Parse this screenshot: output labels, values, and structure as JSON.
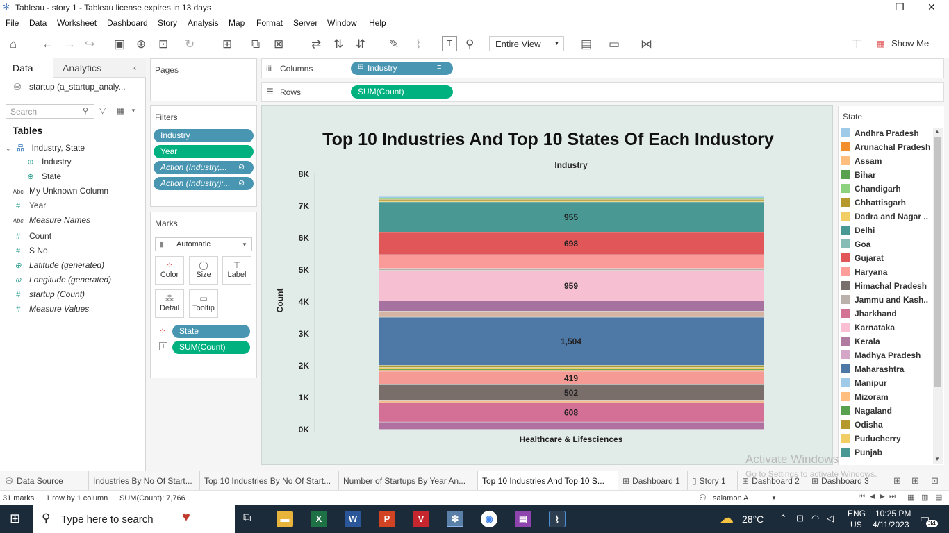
{
  "window": {
    "title": "Tableau - story  1 - Tableau license expires in 13 days"
  },
  "menu": [
    "File",
    "Data",
    "Worksheet",
    "Dashboard",
    "Story",
    "Analysis",
    "Map",
    "Format",
    "Server",
    "Window",
    "Help"
  ],
  "toolbar": {
    "fit": "Entire View",
    "show_me": "Show Me"
  },
  "data_pane": {
    "tabs": [
      "Data",
      "Analytics"
    ],
    "datasource": "startup (a_startup_analy...",
    "search_placeholder": "Search",
    "tables_header": "Tables",
    "group": "Industry, State",
    "fields": [
      "Industry",
      "State",
      "My Unknown Column",
      "Year",
      "Measure Names",
      "Count",
      "S No.",
      "Latitude (generated)",
      "Longitude (generated)",
      "startup (Count)",
      "Measure Values"
    ]
  },
  "shelves": {
    "pages": "Pages",
    "filters": "Filters",
    "filter_pills": [
      "Industry",
      "Year",
      "Action (Industry,...",
      "Action (Industry):..."
    ],
    "marks": "Marks",
    "mark_type": "Automatic",
    "mark_buttons": [
      "Color",
      "Size",
      "Label",
      "Detail",
      "Tooltip"
    ],
    "mark_pills": [
      "State",
      "SUM(Count)"
    ],
    "columns_label": "Columns",
    "columns_pill": "Industry",
    "rows_label": "Rows",
    "rows_pill": "SUM(Count)"
  },
  "chart_data": {
    "type": "bar",
    "title": "Top 10 Industries And Top 10 States Of Each Industory",
    "header": "Industry",
    "xlabel": "Healthcare & Lifesciences",
    "ylabel": "Count",
    "ylim": [
      0,
      8000
    ],
    "yticks": [
      "0K",
      "1K",
      "2K",
      "3K",
      "4K",
      "5K",
      "6K",
      "7K",
      "8K"
    ],
    "categories": [
      "Healthcare & Lifesciences"
    ],
    "segments": [
      {
        "state": "Kerala",
        "value": 230,
        "color": "#b070a0",
        "label": ""
      },
      {
        "state": "Jharkhand",
        "value": 608,
        "color": "#d46f96",
        "label": "608"
      },
      {
        "state": "Mizoram",
        "value": 60,
        "color": "#f4b98c",
        "label": ""
      },
      {
        "state": "Himachal Pradesh",
        "value": 502,
        "color": "#7a6e6b",
        "label": "502"
      },
      {
        "state": "Haryana",
        "value": 419,
        "color": "#f59a94",
        "label": "419"
      },
      {
        "state": "Arunachal Pradesh",
        "value": 40,
        "color": "#f28e2b",
        "label": ""
      },
      {
        "state": "Bihar",
        "value": 40,
        "color": "#5ea04a",
        "label": ""
      },
      {
        "state": "Puducherry",
        "value": 40,
        "color": "#f1ce63",
        "label": ""
      },
      {
        "state": "Odisha",
        "value": 70,
        "color": "#a89a34",
        "label": ""
      },
      {
        "state": "Maharashtra",
        "value": 1504,
        "color": "#4e79a7",
        "label": "1,504"
      },
      {
        "state": "Madhya Pradesh",
        "value": 190,
        "color": "#d5b4a3",
        "label": ""
      },
      {
        "state": "Kerala",
        "value": 320,
        "color": "#a673a0",
        "label": ""
      },
      {
        "state": "Karnataka",
        "value": 959,
        "color": "#f7bfd2",
        "label": "959"
      },
      {
        "state": "Jammu and Kashmir",
        "value": 60,
        "color": "#b8b0ac",
        "label": ""
      },
      {
        "state": "Haryana",
        "value": 430,
        "color": "#fa9b99",
        "label": ""
      },
      {
        "state": "Gujarat",
        "value": 698,
        "color": "#e15759",
        "label": "698"
      },
      {
        "state": "Delhi",
        "value": 955,
        "color": "#499894",
        "label": "955"
      },
      {
        "state": "Dadra and Nagar Haveli",
        "value": 40,
        "color": "#f1ce63",
        "label": ""
      },
      {
        "state": "Chhattisgarh",
        "value": 40,
        "color": "#b6992d",
        "label": ""
      },
      {
        "state": "Chandigarh",
        "value": 30,
        "color": "#8cd17d",
        "label": ""
      },
      {
        "state": "Andhra Pradesh",
        "value": 60,
        "color": "#a0cbe8",
        "label": ""
      }
    ]
  },
  "legend": {
    "title": "State",
    "items": [
      {
        "name": "Andhra Pradesh",
        "color": "#a0cbe8"
      },
      {
        "name": "Arunachal Pradesh",
        "color": "#f28e2b"
      },
      {
        "name": "Assam",
        "color": "#ffbe7d"
      },
      {
        "name": "Bihar",
        "color": "#59a14f"
      },
      {
        "name": "Chandigarh",
        "color": "#8cd17d"
      },
      {
        "name": "Chhattisgarh",
        "color": "#b6992d"
      },
      {
        "name": "Dadra and Nagar ..",
        "color": "#f1ce63"
      },
      {
        "name": "Delhi",
        "color": "#499894"
      },
      {
        "name": "Goa",
        "color": "#86bcb6"
      },
      {
        "name": "Gujarat",
        "color": "#e15759"
      },
      {
        "name": "Haryana",
        "color": "#ff9d9a"
      },
      {
        "name": "Himachal Pradesh",
        "color": "#79706e"
      },
      {
        "name": "Jammu and Kash..",
        "color": "#bab0ac"
      },
      {
        "name": "Jharkhand",
        "color": "#d37295"
      },
      {
        "name": "Karnataka",
        "color": "#fabfd2"
      },
      {
        "name": "Kerala",
        "color": "#b07aa1"
      },
      {
        "name": "Madhya Pradesh",
        "color": "#d4a6c8"
      },
      {
        "name": "Maharashtra",
        "color": "#4e79a7"
      },
      {
        "name": "Manipur",
        "color": "#a0cbe8"
      },
      {
        "name": "Mizoram",
        "color": "#ffbe7d"
      },
      {
        "name": "Nagaland",
        "color": "#59a14f"
      },
      {
        "name": "Odisha",
        "color": "#b6992d"
      },
      {
        "name": "Puducherry",
        "color": "#f1ce63"
      },
      {
        "name": "Punjab",
        "color": "#499894"
      }
    ]
  },
  "sheet_tabs": [
    "Data Source",
    "Industries By No Of Start...",
    "Top 10 Industries By No Of Start...",
    "Number of Startups By Year An...",
    "Top 10 Industries And Top 10 S...",
    "Dashboard 1",
    "Story 1",
    "Dashboard 2",
    "Dashboard 3"
  ],
  "status": {
    "marks": "31 marks",
    "dims": "1 row by 1 column",
    "sum": "SUM(Count): 7,766",
    "user": "salamon  A"
  },
  "watermark": {
    "line1": "Activate Windows",
    "line2": "Go to Settings to activate Windows."
  },
  "taskbar": {
    "search": "Type here to search",
    "temp": "28°C",
    "lang1": "ENG",
    "lang2": "US",
    "time": "10:25 PM",
    "date": "4/11/2023",
    "notif": "34"
  }
}
